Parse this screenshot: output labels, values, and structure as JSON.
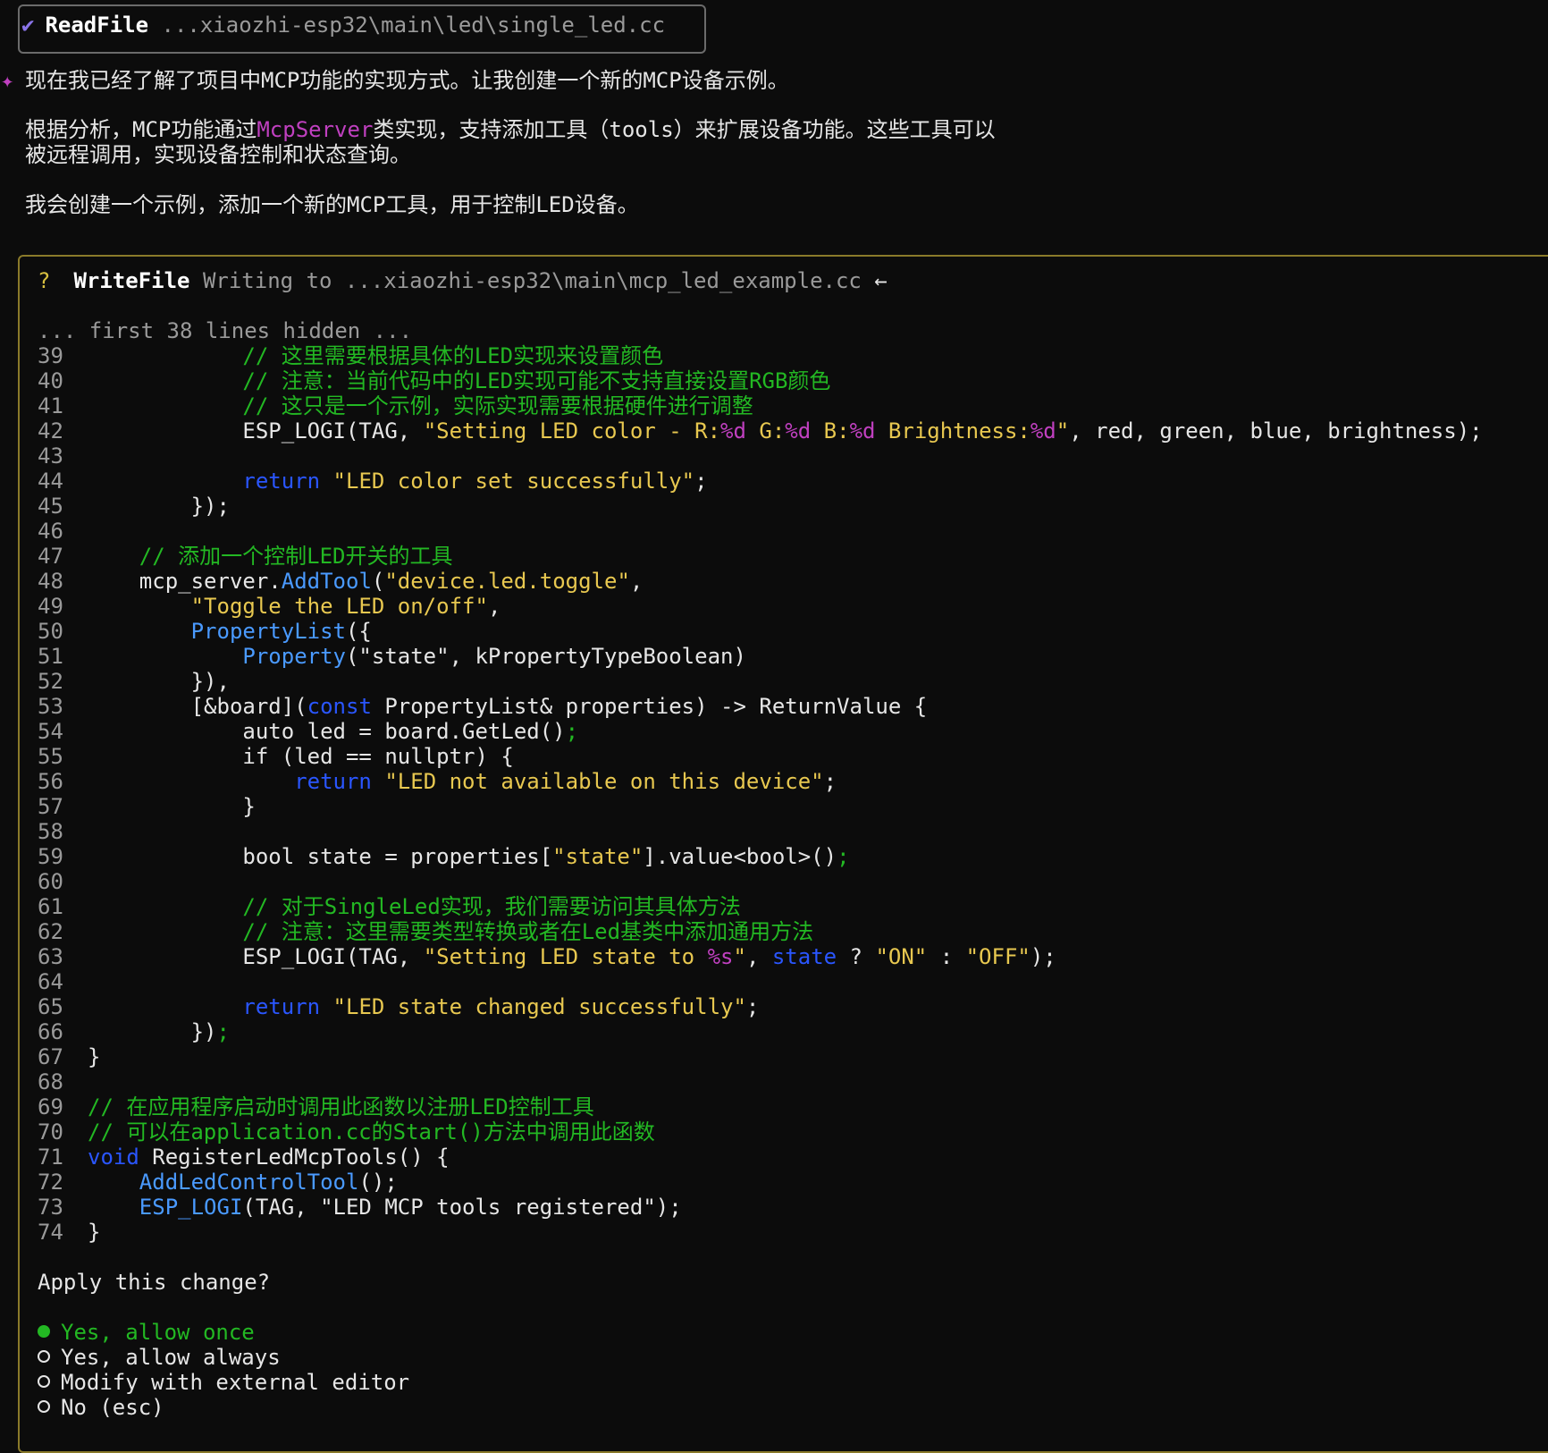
{
  "readfile": {
    "check_icon": "checkmark-icon",
    "tool": "ReadFile",
    "path": "...xiaozhi-esp32\\main\\led\\single_led.cc"
  },
  "message": {
    "sparkle_icon": "sparkle-icon",
    "line1": "现在我已经了解了项目中MCP功能的实现方式。让我创建一个新的MCP设备示例。",
    "line2_prefix": "根据分析，MCP功能通过",
    "line2_highlight": "McpServer",
    "line2_suffix": "类实现，支持添加工具（tools）来扩展设备功能。这些工具可以",
    "line3": "被远程调用，实现设备控制和状态查询。",
    "line4": "我会创建一个示例，添加一个新的MCP工具，用于控制LED设备。"
  },
  "writefile": {
    "question_mark": "?",
    "tool": "WriteFile",
    "action": "Writing to",
    "path": "...xiaozhi-esp32\\main\\mcp_led_example.cc",
    "arrow": "←",
    "hidden_note": "... first 38 lines hidden ..."
  },
  "code_lines": [
    {
      "n": "39",
      "segs": [
        {
          "t": "            "
        },
        {
          "t": "// 这里需要根据具体的LED实现来设置颜色",
          "c": "cm"
        }
      ]
    },
    {
      "n": "40",
      "segs": [
        {
          "t": "            "
        },
        {
          "t": "// 注意：当前代码中的LED实现可能不支持直接设置RGB颜色",
          "c": "cm"
        }
      ]
    },
    {
      "n": "41",
      "segs": [
        {
          "t": "            "
        },
        {
          "t": "// 这只是一个示例，实际实现需要根据硬件进行调整",
          "c": "cm"
        }
      ]
    },
    {
      "n": "42",
      "segs": [
        {
          "t": "            ESP_LOGI(TAG, "
        },
        {
          "t": "\"Setting LED color - R:",
          "c": "str"
        },
        {
          "t": "%d",
          "c": "fmt"
        },
        {
          "t": " G:",
          "c": "str"
        },
        {
          "t": "%d",
          "c": "fmt"
        },
        {
          "t": " B:",
          "c": "str"
        },
        {
          "t": "%d",
          "c": "fmt"
        },
        {
          "t": " Brightness:",
          "c": "str"
        },
        {
          "t": "%d",
          "c": "fmt"
        },
        {
          "t": "\"",
          "c": "str"
        },
        {
          "t": ", red, green, blue, brightness);"
        }
      ]
    },
    {
      "n": "43",
      "segs": []
    },
    {
      "n": "44",
      "segs": [
        {
          "t": "            "
        },
        {
          "t": "return",
          "c": "kw"
        },
        {
          "t": " "
        },
        {
          "t": "\"LED color set successfully\"",
          "c": "str"
        },
        {
          "t": ";"
        }
      ]
    },
    {
      "n": "45",
      "segs": [
        {
          "t": "        });"
        }
      ]
    },
    {
      "n": "46",
      "segs": []
    },
    {
      "n": "47",
      "segs": [
        {
          "t": "    "
        },
        {
          "t": "// 添加一个控制LED开关的工具",
          "c": "cm"
        }
      ]
    },
    {
      "n": "48",
      "segs": [
        {
          "t": "    mcp_server."
        },
        {
          "t": "AddTool",
          "c": "fn"
        },
        {
          "t": "("
        },
        {
          "t": "\"device.led.toggle\"",
          "c": "str"
        },
        {
          "t": ","
        }
      ]
    },
    {
      "n": "49",
      "segs": [
        {
          "t": "        "
        },
        {
          "t": "\"Toggle the LED on/off\"",
          "c": "str"
        },
        {
          "t": ","
        }
      ]
    },
    {
      "n": "50",
      "segs": [
        {
          "t": "        "
        },
        {
          "t": "PropertyList",
          "c": "fn"
        },
        {
          "t": "({"
        }
      ]
    },
    {
      "n": "51",
      "segs": [
        {
          "t": "            "
        },
        {
          "t": "Property",
          "c": "fn"
        },
        {
          "t": "(\"state\", kPropertyTypeBoolean)"
        }
      ]
    },
    {
      "n": "52",
      "segs": [
        {
          "t": "        }),"
        }
      ]
    },
    {
      "n": "53",
      "segs": [
        {
          "t": "        [&board]("
        },
        {
          "t": "const",
          "c": "kw"
        },
        {
          "t": " PropertyList& properties) -> ReturnValue {"
        }
      ]
    },
    {
      "n": "54",
      "segs": [
        {
          "t": "            auto led = board.GetLed()"
        },
        {
          "t": ";",
          "c": "punct"
        }
      ]
    },
    {
      "n": "55",
      "segs": [
        {
          "t": "            if (led == nullptr) {"
        }
      ]
    },
    {
      "n": "56",
      "segs": [
        {
          "t": "                "
        },
        {
          "t": "return",
          "c": "kw"
        },
        {
          "t": " "
        },
        {
          "t": "\"LED not available on this device\"",
          "c": "str"
        },
        {
          "t": ";"
        }
      ]
    },
    {
      "n": "57",
      "segs": [
        {
          "t": "            }"
        }
      ]
    },
    {
      "n": "58",
      "segs": []
    },
    {
      "n": "59",
      "segs": [
        {
          "t": "            bool state = properties["
        },
        {
          "t": "\"state\"",
          "c": "str"
        },
        {
          "t": "].value<bool>()"
        },
        {
          "t": ";",
          "c": "punct"
        }
      ]
    },
    {
      "n": "60",
      "segs": []
    },
    {
      "n": "61",
      "segs": [
        {
          "t": "            "
        },
        {
          "t": "// 对于SingleLed实现，我们需要访问其具体方法",
          "c": "cm"
        }
      ]
    },
    {
      "n": "62",
      "segs": [
        {
          "t": "            "
        },
        {
          "t": "// 注意：这里需要类型转换或者在Led基类中添加通用方法",
          "c": "cm"
        }
      ]
    },
    {
      "n": "63",
      "segs": [
        {
          "t": "            ESP_LOGI(TAG, "
        },
        {
          "t": "\"Setting LED state to ",
          "c": "str"
        },
        {
          "t": "%s",
          "c": "fmt"
        },
        {
          "t": "\"",
          "c": "str"
        },
        {
          "t": ", "
        },
        {
          "t": "state",
          "c": "kw"
        },
        {
          "t": " ? "
        },
        {
          "t": "\"ON\"",
          "c": "str"
        },
        {
          "t": " : "
        },
        {
          "t": "\"OFF\"",
          "c": "str"
        },
        {
          "t": ");"
        }
      ]
    },
    {
      "n": "64",
      "segs": []
    },
    {
      "n": "65",
      "segs": [
        {
          "t": "            "
        },
        {
          "t": "return",
          "c": "kw"
        },
        {
          "t": " "
        },
        {
          "t": "\"LED state changed successfully\"",
          "c": "str"
        },
        {
          "t": ";"
        }
      ]
    },
    {
      "n": "66",
      "segs": [
        {
          "t": "        })"
        },
        {
          "t": ";",
          "c": "punct"
        }
      ]
    },
    {
      "n": "67",
      "segs": [
        {
          "t": "}"
        }
      ]
    },
    {
      "n": "68",
      "segs": []
    },
    {
      "n": "69",
      "segs": [
        {
          "t": "// 在应用程序启动时调用此函数以注册LED控制工具",
          "c": "cm"
        }
      ]
    },
    {
      "n": "70",
      "segs": [
        {
          "t": "// 可以在application.cc的Start()方法中调用此函数",
          "c": "cm"
        }
      ]
    },
    {
      "n": "71",
      "segs": [
        {
          "t": "void",
          "c": "kw"
        },
        {
          "t": " RegisterLedMcpTools() {"
        }
      ]
    },
    {
      "n": "72",
      "segs": [
        {
          "t": "    "
        },
        {
          "t": "AddLedControlTool",
          "c": "fn"
        },
        {
          "t": "();"
        }
      ]
    },
    {
      "n": "73",
      "segs": [
        {
          "t": "    "
        },
        {
          "t": "ESP_LOGI",
          "c": "fn"
        },
        {
          "t": "(TAG, \"LED MCP tools registered\");"
        }
      ]
    },
    {
      "n": "74",
      "segs": [
        {
          "t": "}"
        }
      ]
    }
  ],
  "prompt": {
    "question": "Apply this change?",
    "options": [
      {
        "label": "Yes, allow once",
        "selected": true
      },
      {
        "label": "Yes, allow always",
        "selected": false
      },
      {
        "label": "Modify with external editor",
        "selected": false
      },
      {
        "label": "No (esc)",
        "selected": false
      }
    ]
  }
}
